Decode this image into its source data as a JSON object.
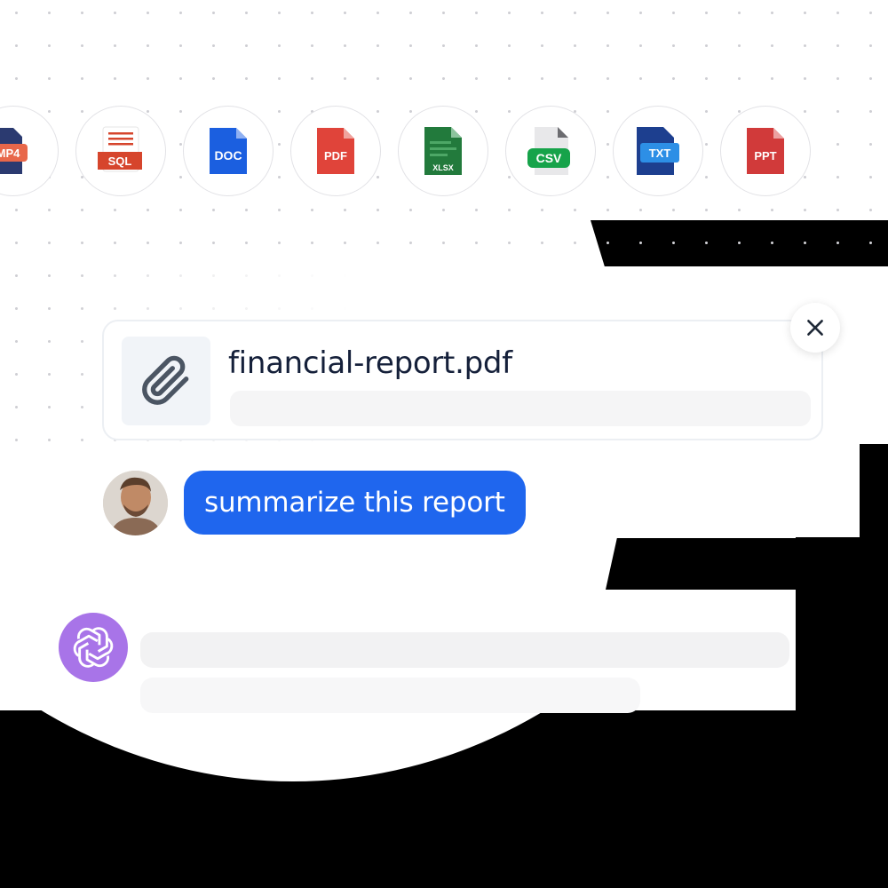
{
  "file_types": [
    {
      "label": "MP4",
      "color": "#e8674a",
      "icon": "mp4-file-icon"
    },
    {
      "label": "SQL",
      "color": "#d6452c",
      "icon": "sql-file-icon"
    },
    {
      "label": "DOC",
      "color": "#1b5fe0",
      "icon": "doc-file-icon"
    },
    {
      "label": "PDF",
      "color": "#e0443a",
      "icon": "pdf-file-icon"
    },
    {
      "label": "XLSX",
      "color": "#227a3c",
      "icon": "xlsx-file-icon"
    },
    {
      "label": "CSV",
      "color": "#16a34a",
      "icon": "csv-file-icon"
    },
    {
      "label": "TXT",
      "color": "#1d3f8f",
      "icon": "txt-file-icon"
    },
    {
      "label": "PPT",
      "color": "#d13a3a",
      "icon": "ppt-file-icon"
    }
  ],
  "attachment": {
    "file_name": "financial-report.pdf",
    "icon": "paperclip-icon",
    "close_icon": "close-icon"
  },
  "user_message": {
    "text": "summarize this report",
    "bubble_color": "#1f66ee"
  },
  "assistant": {
    "icon": "openai-logo-icon",
    "avatar_color": "#a874e8"
  }
}
